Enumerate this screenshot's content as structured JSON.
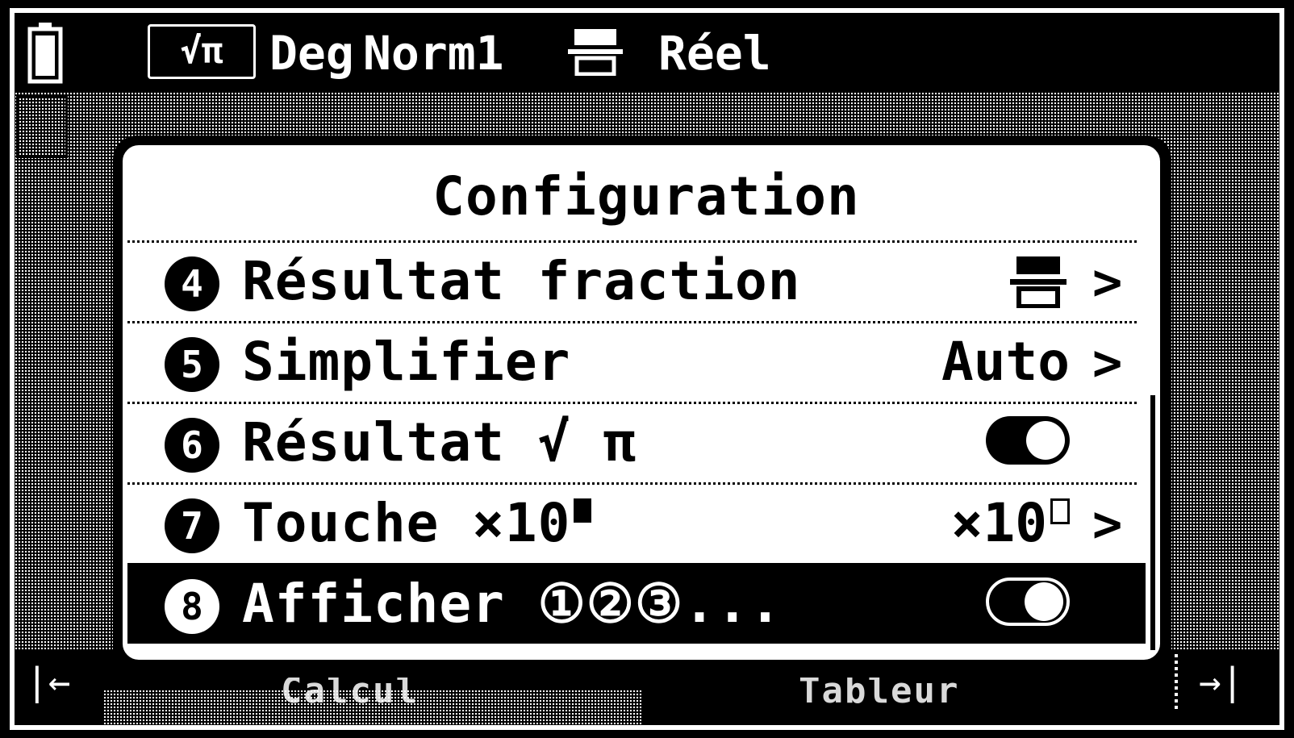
{
  "status_bar": {
    "mode_label": "√π",
    "angle_mode": "Deg",
    "number_format": "Norm1",
    "complex_mode": "Réel"
  },
  "bottom_bar": {
    "left_label": "Calcul",
    "right_label": "Tableur"
  },
  "dialog": {
    "title": "Configuration",
    "items": [
      {
        "num": "4",
        "label": "Résultat fraction",
        "value_icon": "fraction-format-icon",
        "chevron": ">"
      },
      {
        "num": "5",
        "label": "Simplifier",
        "value": "Auto",
        "chevron": ">"
      },
      {
        "num": "6",
        "label": "Résultat √ π",
        "toggle": true
      },
      {
        "num": "7",
        "label": "Touche ×10",
        "value": "×10",
        "chevron": ">"
      },
      {
        "num": "8",
        "label": "Afficher ①②③...",
        "toggle": true,
        "selected": true
      }
    ]
  }
}
